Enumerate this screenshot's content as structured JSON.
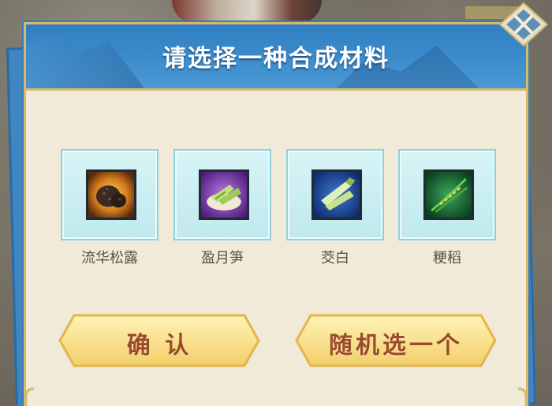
{
  "dialog": {
    "title": "请选择一种合成材料"
  },
  "materials": [
    {
      "name": "流华松露",
      "icon": "truffle-icon"
    },
    {
      "name": "盈月笋",
      "icon": "bamboo-shoot-icon"
    },
    {
      "name": "茭白",
      "icon": "water-bamboo-icon"
    },
    {
      "name": "粳稻",
      "icon": "rice-icon"
    }
  ],
  "buttons": {
    "confirm": "确 认",
    "random": "随机选一个"
  },
  "colors": {
    "header_blue": "#3d8dcd",
    "panel_cream": "#f1ead8",
    "slot_cyan": "#bfe9ee",
    "button_gold": "#f7df88",
    "button_text": "#9b4a2a"
  }
}
